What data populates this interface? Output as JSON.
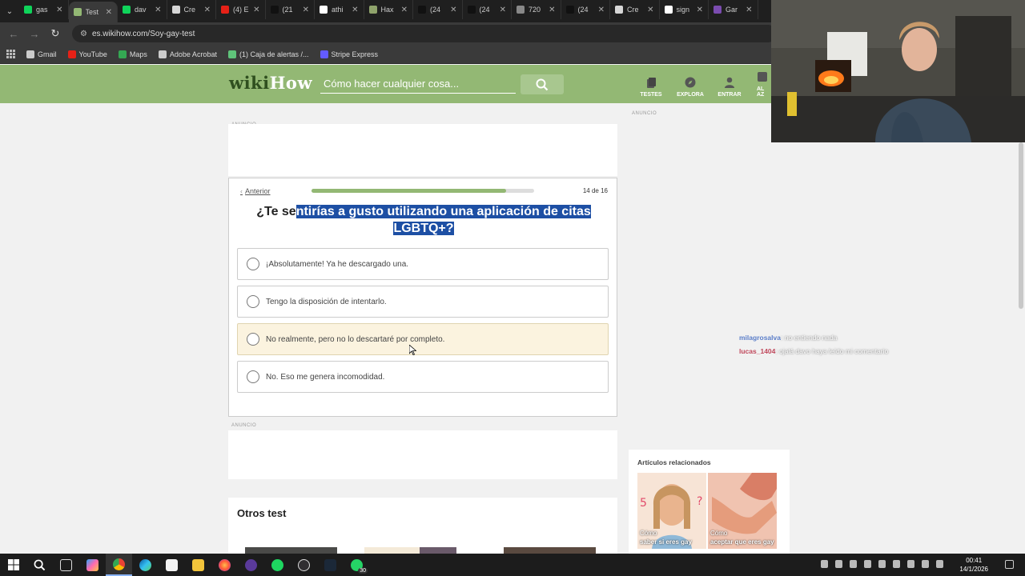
{
  "browser": {
    "tabs": [
      {
        "title": "gas",
        "color": "#0fd45a"
      },
      {
        "title": "Test",
        "color": "#93b874",
        "active": true
      },
      {
        "title": "dav",
        "color": "#0fd45a"
      },
      {
        "title": "Cre",
        "color": "#d6d6d6"
      },
      {
        "title": "(4) E",
        "color": "#e62117"
      },
      {
        "title": "(21",
        "color": "#111111"
      },
      {
        "title": "athi",
        "color": "#ffffff"
      },
      {
        "title": "Hax",
        "color": "#8fa36b"
      },
      {
        "title": "(24",
        "color": "#111111"
      },
      {
        "title": "(24",
        "color": "#111111"
      },
      {
        "title": "720",
        "color": "#888888"
      },
      {
        "title": "(24",
        "color": "#111111"
      },
      {
        "title": "Cre",
        "color": "#d6d6d6"
      },
      {
        "title": "sign",
        "color": "#ffffff"
      },
      {
        "title": "Gar",
        "color": "#7b4cb0"
      }
    ],
    "url": "es.wikihow.com/Soy-gay-test",
    "bookmarks": [
      {
        "label": "Gmail",
        "color": "#cccccc"
      },
      {
        "label": "YouTube",
        "color": "#e62117"
      },
      {
        "label": "Maps",
        "color": "#34a853"
      },
      {
        "label": "Adobe Acrobat",
        "color": "#cccccc"
      },
      {
        "label": "(1) Caja de alertas /...",
        "color": "#5fc37a"
      },
      {
        "label": "Stripe Express",
        "color": "#635bff"
      }
    ]
  },
  "site": {
    "logo_wiki": "wiki",
    "logo_how": "How",
    "search_placeholder": "Cómo hacer cualquier cosa...",
    "nav": [
      {
        "label": "TESTES",
        "icon": "quiz-icon"
      },
      {
        "label": "EXPLORA",
        "icon": "compass-icon"
      },
      {
        "label": "ENTRAR",
        "icon": "user-icon"
      },
      {
        "label": "AL AZ",
        "icon": "dice-icon"
      }
    ],
    "ad_label": "ANUNCIO"
  },
  "quiz": {
    "prev_label": "Anterior",
    "counter": "14 de 16",
    "progress": 0.875,
    "question_plain": "¿Te se",
    "question_selected": "ntirías a gusto utilizando una aplicación de citas LGBTQ+?",
    "options": [
      "¡Absolutamente! Ya he descargado una.",
      "Tengo la disposición de intentarlo.",
      "No realmente, pero no lo descartaré por completo.",
      "No. Eso me genera incomodidad."
    ]
  },
  "otros": {
    "title": "Otros test"
  },
  "related": {
    "title": "Artículos relacionados",
    "cards": [
      {
        "how": "Cómo",
        "text": "saber si eres gay"
      },
      {
        "how": "Cómo",
        "text": "aceptar que eres gay"
      }
    ]
  },
  "chat": [
    {
      "user": "milagrosalva",
      "message": ": no entiendo nada"
    },
    {
      "user": "lucas_1404",
      "message": ": ojalá davo haya leído mi comentario"
    }
  ],
  "taskbar": {
    "time": "00:41",
    "date": "14/1/2026",
    "whatsapp_badge": "30"
  }
}
